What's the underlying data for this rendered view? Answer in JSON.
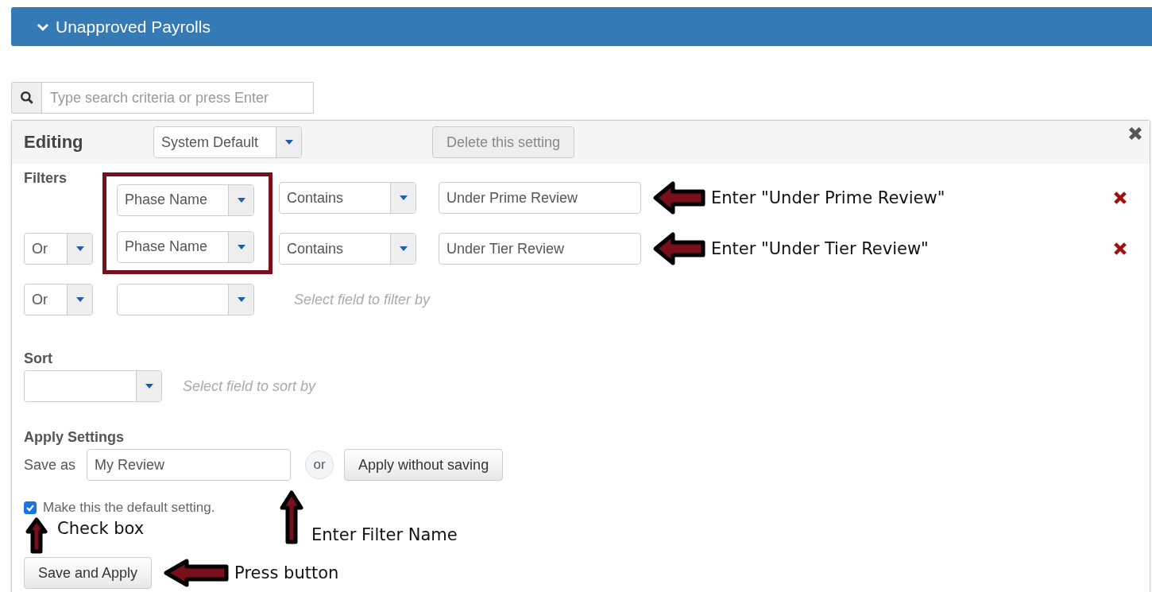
{
  "header": {
    "title": "Unapproved Payrolls",
    "expanded": true
  },
  "search": {
    "placeholder": "Type search criteria or press Enter"
  },
  "editor": {
    "title": "Editing",
    "setting": "System Default",
    "delete_button": "Delete this setting"
  },
  "filters": {
    "label": "Filters",
    "rows": [
      {
        "field": "Phase Name",
        "operator": "Contains",
        "value": "Under Prime Review",
        "highlighted": true,
        "note": "Enter \"Under Prime Review\""
      },
      {
        "connector": "Or",
        "field": "Phase Name",
        "operator": "Contains",
        "value": "Under Tier Review",
        "highlighted": true,
        "note": "Enter \"Under Tier Review\""
      },
      {
        "connector": "Or",
        "hint": "Select field to filter by",
        "highlighted": false
      }
    ]
  },
  "sort": {
    "label": "Sort",
    "hint": "Select field to sort by"
  },
  "apply": {
    "label": "Apply Settings",
    "save_as_label": "Save as",
    "name_value": "My Review",
    "name_note": "Enter Filter Name",
    "or": "or",
    "apply_button": "Apply without saving",
    "default_checkbox": {
      "label": "Make this the default setting.",
      "checked": true,
      "note": "Check box"
    },
    "save_button": "Save and Apply",
    "save_note": "Press button"
  }
}
